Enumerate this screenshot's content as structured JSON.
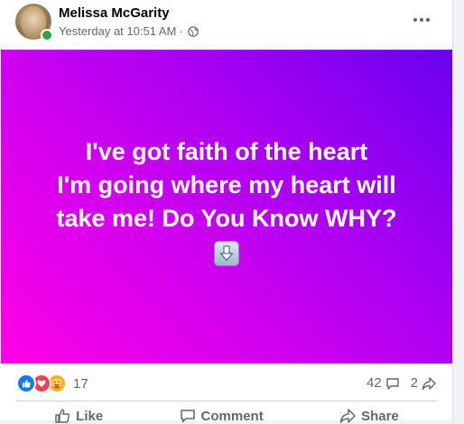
{
  "post": {
    "author": "Melissa McGarity",
    "timestamp": "Yesterday at 10:51 AM",
    "separator": "·",
    "privacy_icon": "globe-icon",
    "online_color": "#31a24c",
    "background_gradient": [
      "#6a00f0",
      "#ff00e6"
    ],
    "text_lines": [
      "I've got faith of the heart",
      "I'm going where my heart will",
      "take me! Do You Know WHY?"
    ],
    "emoji": "down-arrow-emoji"
  },
  "reactions": {
    "icons": [
      "like-icon",
      "love-icon",
      "care-icon"
    ],
    "count": "17"
  },
  "stats": {
    "comments": "42",
    "shares": "2"
  },
  "actions": {
    "like": "Like",
    "comment": "Comment",
    "share": "Share"
  }
}
